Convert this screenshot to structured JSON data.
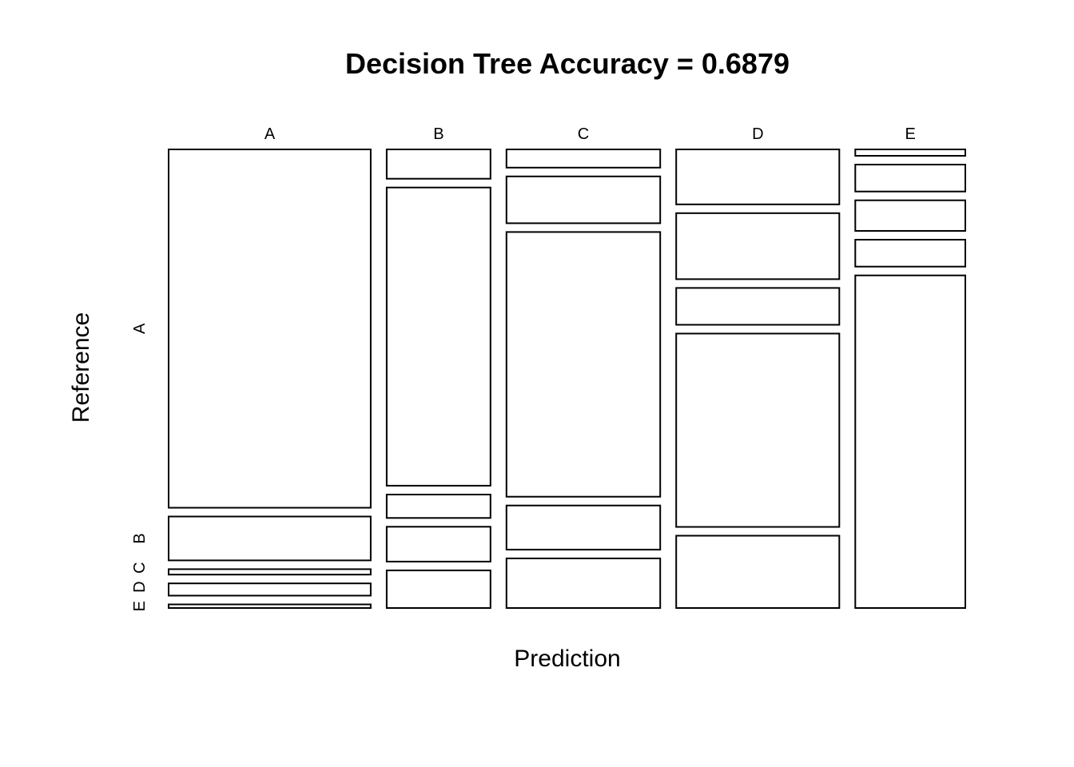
{
  "chart_data": {
    "type": "mosaic",
    "title": "Decision Tree Accuracy =  0.6879",
    "xlabel": "Prediction",
    "ylabel": "Reference",
    "x_categories": [
      "A",
      "B",
      "C",
      "D",
      "E"
    ],
    "y_categories": [
      "A",
      "B",
      "C",
      "D",
      "E"
    ],
    "x_proportions": [
      0.259,
      0.133,
      0.197,
      0.209,
      0.141
    ],
    "conditional_proportions": [
      [
        0.793,
        0.097,
        0.012,
        0.027,
        0.008
      ],
      [
        0.064,
        0.65,
        0.051,
        0.076,
        0.082
      ],
      [
        0.04,
        0.103,
        0.582,
        0.097,
        0.109
      ],
      [
        0.13,
        0.156,
        0.087,
        0.457,
        0.171
      ],
      [
        0.014,
        0.059,
        0.067,
        0.059,
        0.729
      ]
    ]
  }
}
